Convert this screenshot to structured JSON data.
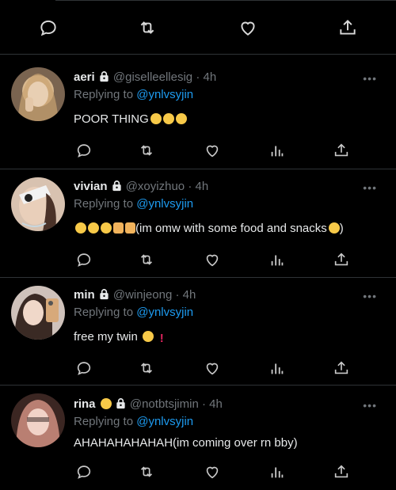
{
  "replies": [
    {
      "name": "aeri",
      "handle": "@giselleellesig",
      "time": "· 4h",
      "replying_prefix": "Replying to",
      "replying_to": "@ynlvsyjin",
      "text": "POOR THING",
      "more": "•••",
      "avatar_color": "#d9b98f"
    },
    {
      "name": "vivian",
      "handle": "@xoyizhuo",
      "time": "· 4h",
      "replying_prefix": "Replying to",
      "replying_to": "@ynlvsyjin",
      "text": "(im omw with some food and snacks",
      "text_end": ")",
      "more": "•••",
      "avatar_color": "#c9a58a"
    },
    {
      "name": "min",
      "handle": "@winjeong",
      "time": "· 4h",
      "replying_prefix": "Replying to",
      "replying_to": "@ynlvsyjin",
      "text": "free my twin",
      "text_end": "!",
      "more": "•••",
      "avatar_color": "#e4c7b8"
    },
    {
      "name": "rina",
      "handle": "@notbtsjimin",
      "time": "· 4h",
      "replying_prefix": "Replying to",
      "replying_to": "@ynlvsyjin",
      "text": "AHAHAHAHAHAH(im coming over rn bby)",
      "more": "•••",
      "avatar_color": "#b3786e"
    }
  ],
  "colors": {
    "background": "#000000",
    "icon": "#71767b",
    "mention": "#1d9bf0",
    "divider": "#2f3336"
  }
}
